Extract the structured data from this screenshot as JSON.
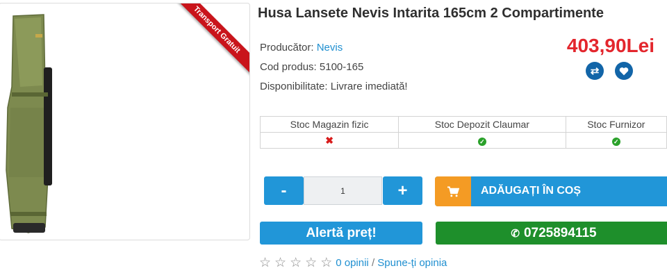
{
  "product": {
    "title": "Husa Lansete Nevis Intarita 165cm 2 Compartimente",
    "ribbon": "Transport Gratuit",
    "producer_label": "Producător: ",
    "producer": "Nevis",
    "code_label": "Cod produs: ",
    "code": "5100-165",
    "availability_label": "Disponibilitate: ",
    "availability": "Livrare imediată!",
    "price": "403,90Lei",
    "image_icon": "rod-bag-image"
  },
  "actions": {
    "compare_icon": "compare-icon",
    "wishlist_icon": "heart-icon"
  },
  "stock": {
    "headers": [
      "Stoc Magazin fizic",
      "Stoc Depozit Claumar",
      "Stoc Furnizor"
    ],
    "status": [
      "unavailable",
      "available",
      "available"
    ]
  },
  "cart": {
    "minus": "-",
    "plus": "+",
    "quantity": "1",
    "add_label": "ADĂUGAȚI ÎN COȘ",
    "cart_icon": "cart-icon"
  },
  "alert": {
    "label": "Alertă preț!"
  },
  "phone": {
    "label": "0725894115",
    "icon": "phone-icon"
  },
  "reviews": {
    "stars": 5,
    "count_label": "0 opinii",
    "separator": " / ",
    "write_label": "Spune-ți opinia"
  },
  "colors": {
    "accent": "#2196d8",
    "price": "#e3262d",
    "cart_icon_bg": "#f49b24",
    "phone_bg": "#1e8f2b",
    "ribbon": "#c9141b"
  }
}
